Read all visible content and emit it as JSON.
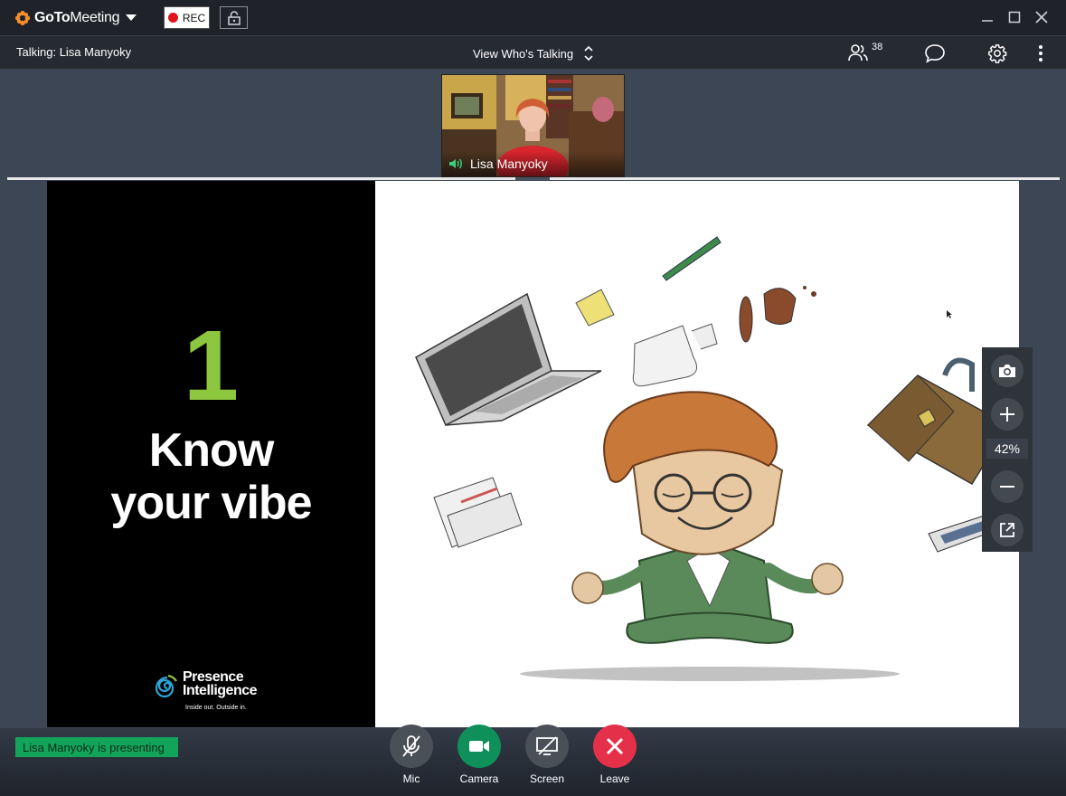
{
  "app": {
    "brand_goto": "GoTo",
    "brand_meeting": "Meeting",
    "rec_label": "REC"
  },
  "infobar": {
    "talking": "Talking: Lisa Manyoky",
    "view_talking": "View Who's Talking",
    "attendee_count": "38"
  },
  "thumbnail": {
    "name": "Lisa Manyoky"
  },
  "slide": {
    "number": "1",
    "title_line1": "Know",
    "title_line2": "your vibe",
    "logo_line1": "Presence",
    "logo_line2": "Intelligence",
    "tagline": "Inside out. Outside in."
  },
  "zoom": {
    "level": "42%"
  },
  "status": {
    "presenting": "Lisa Manyoky is presenting"
  },
  "controls": [
    {
      "label": "Mic",
      "color": "#4a5058"
    },
    {
      "label": "Camera",
      "color": "#0f8f5a"
    },
    {
      "label": "Screen",
      "color": "#4a5058"
    },
    {
      "label": "Leave",
      "color": "#e5304a"
    }
  ],
  "colors": {
    "brand_orange": "#f68d2e",
    "slide_accent": "#8dc63f",
    "presenting_green": "#12a55a"
  }
}
